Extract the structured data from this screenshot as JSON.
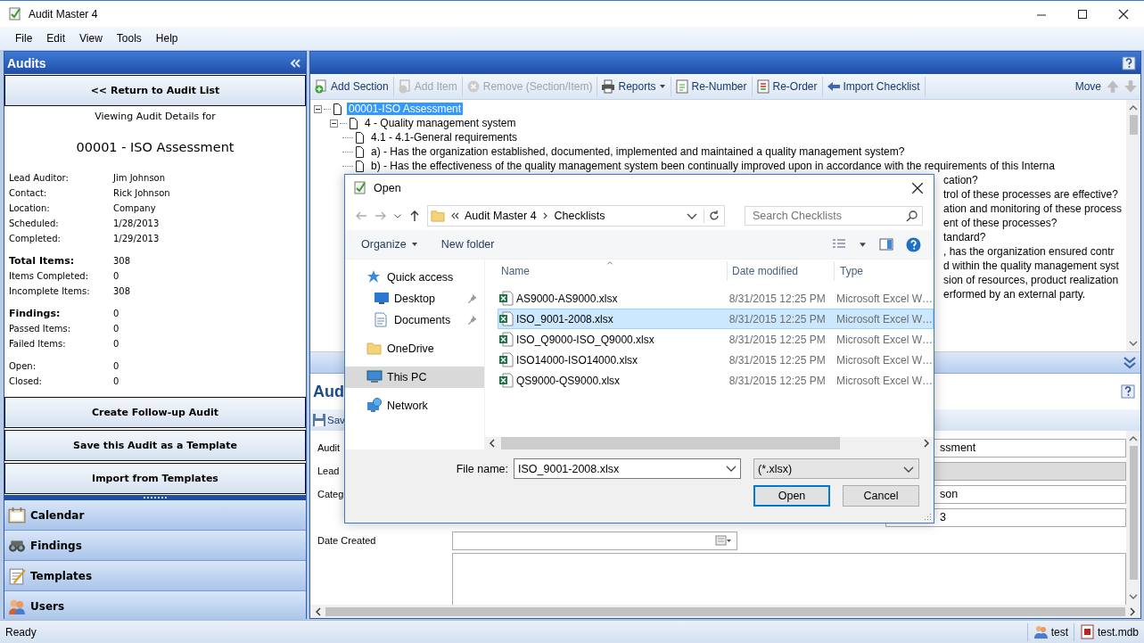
{
  "window": {
    "title": "Audit Master 4"
  },
  "menu": [
    "File",
    "Edit",
    "View",
    "Tools",
    "Help"
  ],
  "sidebar": {
    "title": "Audits",
    "return_button": "<< Return to Audit List",
    "caption": "Viewing Audit Details for",
    "audit_name": "00001 - ISO Assessment",
    "detail_groups": [
      [
        {
          "label": "Lead Auditor:",
          "value": "Jim Johnson",
          "kind": "plain"
        },
        {
          "label": "Contact:",
          "value": "Rick Johnson",
          "kind": "plain"
        },
        {
          "label": "Location:",
          "value": "Company",
          "kind": "plain"
        },
        {
          "label": "Scheduled:",
          "value": "1/28/2013",
          "kind": "plain"
        },
        {
          "label": "Completed:",
          "value": "1/29/2013",
          "kind": "plain"
        }
      ],
      [
        {
          "label": "Total Items:",
          "value": "308",
          "kind": "heading"
        },
        {
          "label": "Items Completed:",
          "value": "0",
          "kind": "plain"
        },
        {
          "label": "Incomplete Items:",
          "value": "308",
          "kind": "plain"
        }
      ],
      [
        {
          "label": "Findings:",
          "value": "0",
          "kind": "heading"
        },
        {
          "label": "Passed Items:",
          "value": "0",
          "kind": "plain"
        },
        {
          "label": "Failed Items:",
          "value": "0",
          "kind": "plain"
        }
      ],
      [
        {
          "label": "Open:",
          "value": "0",
          "kind": "plain"
        },
        {
          "label": "Closed:",
          "value": "0",
          "kind": "plain"
        }
      ]
    ],
    "actions": [
      "Create Follow-up Audit",
      "Save this Audit as a Template",
      "Import from Templates"
    ],
    "nav": [
      {
        "label": "Calendar",
        "kind": "calendar"
      },
      {
        "label": "Findings",
        "kind": "binoculars"
      },
      {
        "label": "Templates",
        "kind": "templates"
      },
      {
        "label": "Users",
        "kind": "users"
      }
    ]
  },
  "checklist": {
    "toolbar": [
      {
        "label": "Add Section",
        "kind": "add-section",
        "disabled": false,
        "dropdown": false
      },
      {
        "label": "Add Item",
        "kind": "add-item",
        "disabled": true,
        "dropdown": false
      },
      {
        "label": "Remove (Section/Item)",
        "kind": "remove",
        "disabled": true,
        "dropdown": false
      },
      {
        "label": "Reports",
        "kind": "reports",
        "disabled": false,
        "dropdown": true
      },
      {
        "label": "Re-Number",
        "kind": "renumber",
        "disabled": false,
        "dropdown": false
      },
      {
        "label": "Re-Order",
        "kind": "reorder",
        "disabled": false,
        "dropdown": false
      },
      {
        "label": "Import Checklist",
        "kind": "import",
        "disabled": false,
        "dropdown": false
      }
    ],
    "move_label": "Move",
    "tree": [
      {
        "text": "00001-ISO Assessment",
        "kind": "node",
        "selected": true,
        "expanded": true,
        "children": [
          {
            "text": "4 - Quality management system",
            "kind": "node",
            "selected": false,
            "expanded": true,
            "children": [
              {
                "text": "4.1 - 4.1-General requirements",
                "kind": "node",
                "selected": false
              },
              {
                "text": "a) - Has the organization established, documented, implemented and maintained a quality management system?",
                "kind": "node",
                "selected": false
              },
              {
                "text": "b) - Has the effectiveness of the quality management system been continually improved upon in accordance with the requirements of this Interna",
                "kind": "node",
                "selected": false
              },
              {
                "text": "cation?",
                "kind": "covered",
                "selected": false
              },
              {
                "text": "trol of these processes are effective?",
                "kind": "covered",
                "selected": false
              },
              {
                "text": "ation and monitoring of these process",
                "kind": "covered",
                "selected": false
              },
              {
                "text": "ent of these processes?",
                "kind": "covered",
                "selected": false
              },
              {
                "text": "tandard?",
                "kind": "covered",
                "selected": false
              },
              {
                "text": ", has the organization ensured contr",
                "kind": "covered",
                "selected": false
              },
              {
                "text": "d within the quality management syst",
                "kind": "covered",
                "selected": false
              },
              {
                "text": "sion of resources, product realization",
                "kind": "covered",
                "selected": false
              },
              {
                "text": "erformed by an external party.",
                "kind": "covered",
                "selected": false
              }
            ]
          }
        ]
      }
    ]
  },
  "details": {
    "title": "Aud",
    "toolbar_button": "Sav",
    "rows": [
      {
        "label": "Audit",
        "value": "ssment",
        "kind": "text"
      },
      {
        "label": "Lead",
        "kind": "disabled"
      },
      {
        "label": "Categ",
        "value": "son",
        "kind": "text"
      },
      {
        "value": "3",
        "kind": "text"
      },
      {
        "label": "Date Created",
        "kind": "date"
      }
    ]
  },
  "dialog": {
    "title": "Open",
    "path": [
      "Audit Master 4",
      "Checklists"
    ],
    "search": {
      "placeholder": "Search Checklists"
    },
    "toolbar": [
      {
        "label": "Organize",
        "dropdown": true
      },
      {
        "label": "New folder",
        "dropdown": false
      }
    ],
    "nav": [
      {
        "label": "Quick access",
        "kind": "star",
        "selected": false,
        "children": [
          {
            "label": "Desktop",
            "kind": "desktop",
            "selected": false,
            "pinned": true
          },
          {
            "label": "Documents",
            "kind": "documents",
            "selected": false,
            "pinned": true
          }
        ]
      },
      {
        "label": "OneDrive",
        "kind": "folder",
        "selected": false
      },
      {
        "label": "This PC",
        "kind": "pc",
        "selected": true
      },
      {
        "label": "Network",
        "kind": "network",
        "selected": false
      }
    ],
    "columns": [
      "Name",
      "Date modified",
      "Type"
    ],
    "files": [
      {
        "name": "AS9000-AS9000.xlsx",
        "date": "8/31/2015 12:25 PM",
        "type": "Microsoft Excel W…",
        "selected": false
      },
      {
        "name": "ISO_9001-2008.xlsx",
        "date": "8/31/2015 12:25 PM",
        "type": "Microsoft Excel W…",
        "selected": true
      },
      {
        "name": "ISO_Q9000-ISO_Q9000.xlsx",
        "date": "8/31/2015 12:25 PM",
        "type": "Microsoft Excel W…",
        "selected": false
      },
      {
        "name": "ISO14000-ISO14000.xlsx",
        "date": "8/31/2015 12:25 PM",
        "type": "Microsoft Excel W…",
        "selected": false
      },
      {
        "name": "QS9000-QS9000.xlsx",
        "date": "8/31/2015 12:25 PM",
        "type": "Microsoft Excel W…",
        "selected": false
      }
    ],
    "file_name_label": "File name:",
    "file_name": "ISO_9001-2008.xlsx",
    "filter": "(*.xlsx)",
    "buttons": [
      "Open",
      "Cancel"
    ]
  },
  "status_bar": {
    "text": "Ready",
    "user": "test",
    "database": "test.mdb"
  }
}
